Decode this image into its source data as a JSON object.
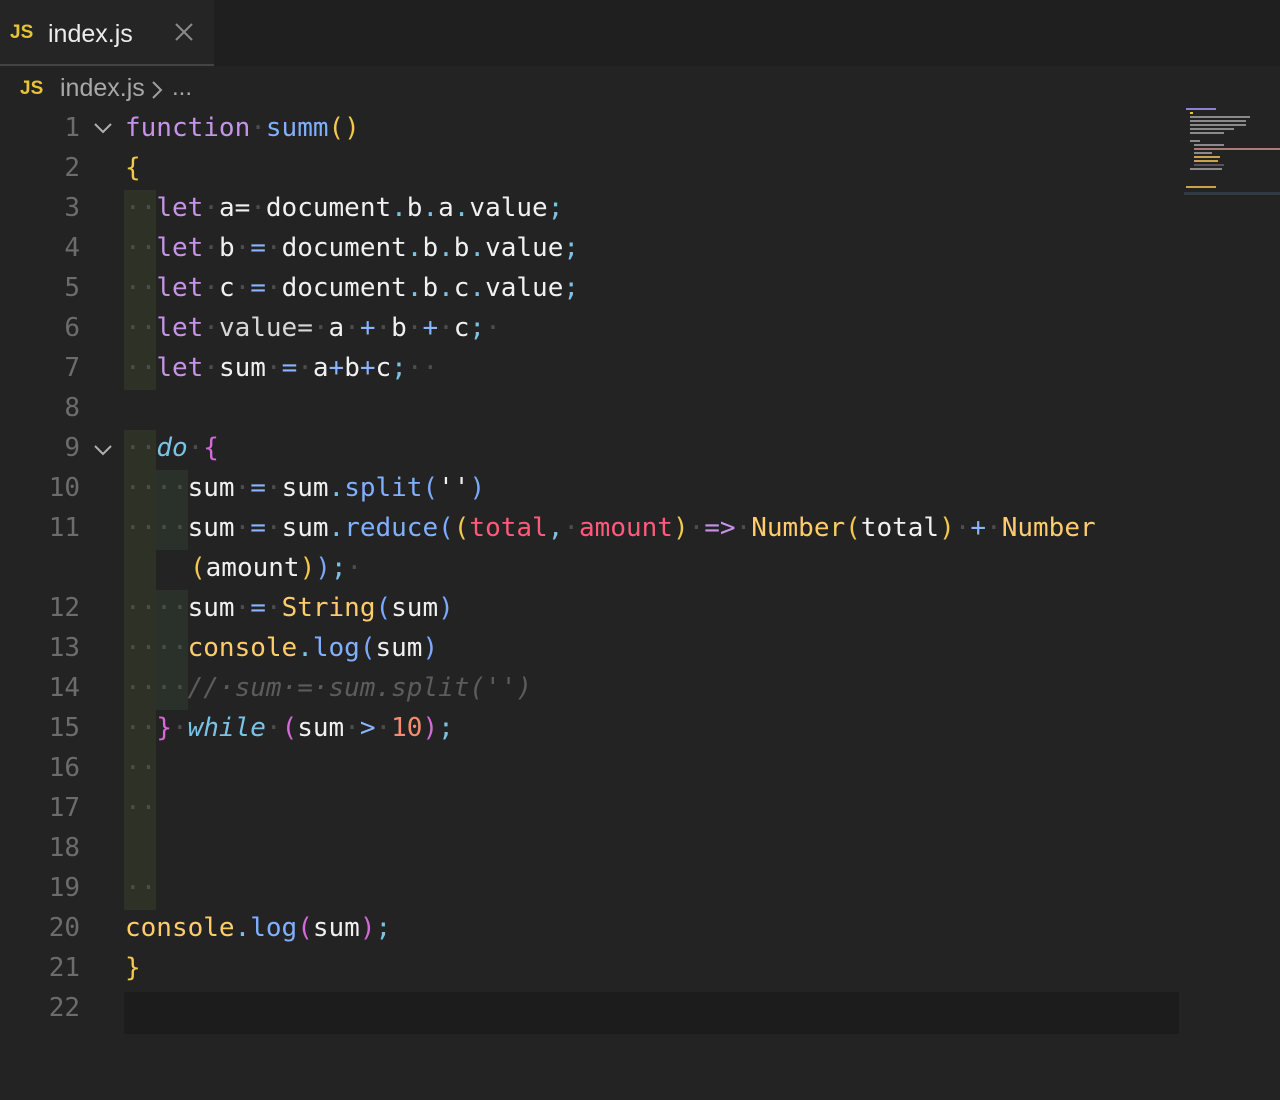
{
  "tab": {
    "icon_label": "JS",
    "filename": "index.js",
    "accent": "#e8c33a"
  },
  "breadcrumb": {
    "icon_label": "JS",
    "file": "index.js",
    "more": "..."
  },
  "line_numbers": [
    "1",
    "2",
    "3",
    "4",
    "5",
    "6",
    "7",
    "8",
    "9",
    "10",
    "11",
    "12",
    "13",
    "14",
    "15",
    "16",
    "17",
    "18",
    "19",
    "20",
    "21",
    "22"
  ],
  "code": {
    "l1_kw": "function",
    "l1_fn": "summ",
    "l1_parens": "()",
    "l2_open": "{",
    "l3": [
      "let",
      "a=",
      "document",
      ".",
      "b",
      ".",
      "a",
      ".",
      "value",
      ";"
    ],
    "l4": [
      "let",
      "b",
      "=",
      "document",
      ".",
      "b",
      ".",
      "b",
      ".",
      "value",
      ";"
    ],
    "l5": [
      "let",
      "c",
      "=",
      "document",
      ".",
      "b",
      ".",
      "c",
      ".",
      "value",
      ";"
    ],
    "l6": [
      "let",
      "value=",
      "a",
      "+",
      "b",
      "+",
      "c",
      ";"
    ],
    "l7": [
      "let",
      "sum",
      "=",
      "a",
      "+",
      "b",
      "+",
      "c",
      ";"
    ],
    "l9": [
      "do",
      "{"
    ],
    "l10": [
      "sum",
      "=",
      "sum",
      ".",
      "split",
      "(",
      "''",
      ")"
    ],
    "l11a": [
      "sum",
      "=",
      "sum",
      ".",
      "reduce",
      "(",
      "(",
      "total",
      ",",
      "amount",
      ")",
      "=>",
      "Number",
      "(",
      "total",
      ")",
      "+",
      "Number"
    ],
    "l11b": [
      "(",
      "amount",
      ")",
      ")",
      ";"
    ],
    "l12": [
      "sum",
      "=",
      "String",
      "(",
      "sum",
      ")"
    ],
    "l13": [
      "console",
      ".",
      "log",
      "(",
      "sum",
      ")"
    ],
    "l14": "//·sum·=·sum.split('')",
    "l15": [
      "}",
      "while",
      "(",
      "sum",
      ">",
      "10",
      ")",
      ";"
    ],
    "l20": [
      "console",
      ".",
      "log",
      "(",
      "sum",
      ")",
      ";"
    ],
    "l21": "}"
  }
}
